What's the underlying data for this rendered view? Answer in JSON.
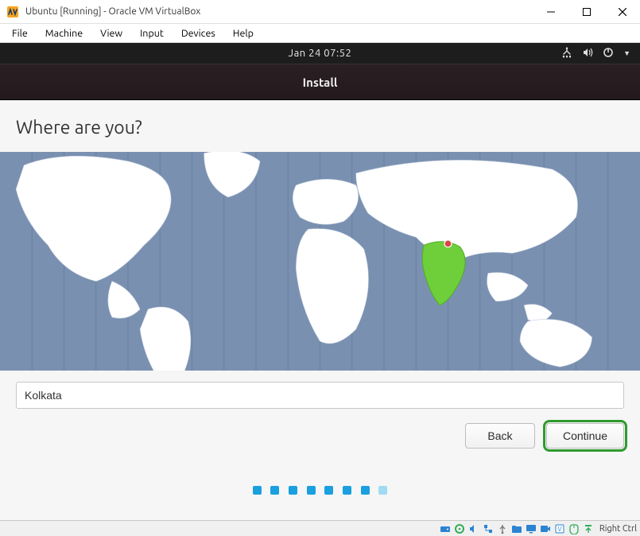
{
  "window": {
    "title": "Ubuntu [Running] - Oracle VM VirtualBox"
  },
  "host_menu": [
    "File",
    "Machine",
    "View",
    "Input",
    "Devices",
    "Help"
  ],
  "gnome": {
    "clock": "Jan 24  07:52"
  },
  "installer": {
    "header": "Install",
    "heading": "Where are you?",
    "timezone_value": "Kolkata",
    "back_label": "Back",
    "continue_label": "Continue",
    "selected_region": "India",
    "progress_total": 8,
    "progress_current": 8
  },
  "host_status": {
    "capture_key": "Right Ctrl"
  },
  "colors": {
    "map_ocean": "#7a90b0",
    "map_land": "#ffffff",
    "map_highlight": "#6fcf3a",
    "accent": "#1aa0de",
    "continue_outline": "#2e9b2e"
  }
}
